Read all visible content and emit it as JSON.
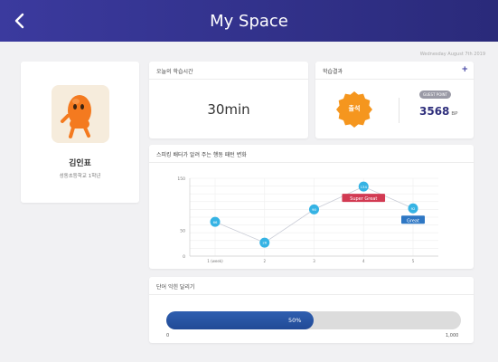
{
  "header": {
    "title": "My Space"
  },
  "date": "Wednesday August 7th 2019",
  "profile": {
    "name": "김인표",
    "school": "성동초등학교 1학년"
  },
  "study_time": {
    "title": "오늘의 학습시간",
    "value": "30min"
  },
  "results": {
    "title": "학습결과",
    "badge": "출석",
    "pill": "GUEST POINT",
    "points": "3568",
    "unit": "BP"
  },
  "chart": {
    "title": "스피킹 배터가 알려 주는 행동 패턴 변화"
  },
  "chart_data": {
    "type": "line",
    "categories": [
      "1 (week)",
      "2",
      "3",
      "4",
      "5"
    ],
    "values": [
      66,
      26,
      90,
      134,
      92
    ],
    "point_labels": [
      "66",
      "26",
      "90",
      "134",
      "92"
    ],
    "y_ticks": [
      "150",
      "50",
      "0"
    ],
    "ylim": [
      0,
      150
    ],
    "annotations": [
      {
        "index": 3,
        "text": "Super Great",
        "color": "#d23a52"
      },
      {
        "index": 4,
        "text": "Great",
        "color": "#2e77c4"
      }
    ],
    "grid": true
  },
  "words": {
    "title": "단어 익힌 달리기",
    "progress": 0.5,
    "progress_label": "50%",
    "min": "0",
    "max": "1,000"
  },
  "colors": {
    "header": "#2f2f86",
    "badge": "#f5961e",
    "point": "#35b3e4"
  }
}
